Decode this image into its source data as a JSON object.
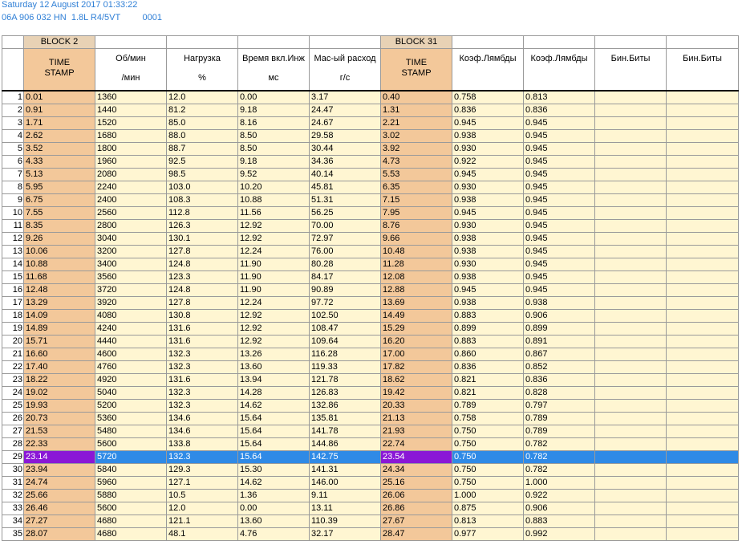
{
  "header": {
    "datetime": "Saturday 12 August 2017 01:33:22",
    "ecu": "06A 906 032 HN  1.8L R4/5VT         0001"
  },
  "blocks": {
    "left": "BLOCK 2",
    "right": "BLOCK 31"
  },
  "columns": [
    {
      "l1": "TIME",
      "l2": "STAMP",
      "ts": true
    },
    {
      "l1": "Об/мин",
      "l2": "/мин"
    },
    {
      "l1": "Нагрузка",
      "l2": "%"
    },
    {
      "l1": "Время вкл.Инж",
      "l2": "мс"
    },
    {
      "l1": "Мас-ый расход",
      "l2": "г/с"
    },
    {
      "l1": "TIME",
      "l2": "STAMP",
      "ts": true
    },
    {
      "l1": "Коэф.Лямбды",
      "l2": ""
    },
    {
      "l1": "Коэф.Лямбды",
      "l2": ""
    },
    {
      "l1": "Бин.Биты",
      "l2": ""
    },
    {
      "l1": "Бин.Биты",
      "l2": ""
    }
  ],
  "selected_row": 29,
  "rows": [
    [
      "1",
      "0.01",
      "1360",
      "12.0",
      "0.00",
      "3.17",
      "0.40",
      "0.758",
      "0.813",
      "",
      ""
    ],
    [
      "2",
      "0.91",
      "1440",
      "81.2",
      "9.18",
      "24.47",
      "1.31",
      "0.836",
      "0.836",
      "",
      ""
    ],
    [
      "3",
      "1.71",
      "1520",
      "85.0",
      "8.16",
      "24.67",
      "2.21",
      "0.945",
      "0.945",
      "",
      ""
    ],
    [
      "4",
      "2.62",
      "1680",
      "88.0",
      "8.50",
      "29.58",
      "3.02",
      "0.938",
      "0.945",
      "",
      ""
    ],
    [
      "5",
      "3.52",
      "1800",
      "88.7",
      "8.50",
      "30.44",
      "3.92",
      "0.930",
      "0.945",
      "",
      ""
    ],
    [
      "6",
      "4.33",
      "1960",
      "92.5",
      "9.18",
      "34.36",
      "4.73",
      "0.922",
      "0.945",
      "",
      ""
    ],
    [
      "7",
      "5.13",
      "2080",
      "98.5",
      "9.52",
      "40.14",
      "5.53",
      "0.945",
      "0.945",
      "",
      ""
    ],
    [
      "8",
      "5.95",
      "2240",
      "103.0",
      "10.20",
      "45.81",
      "6.35",
      "0.930",
      "0.945",
      "",
      ""
    ],
    [
      "9",
      "6.75",
      "2400",
      "108.3",
      "10.88",
      "51.31",
      "7.15",
      "0.938",
      "0.945",
      "",
      ""
    ],
    [
      "10",
      "7.55",
      "2560",
      "112.8",
      "11.56",
      "56.25",
      "7.95",
      "0.945",
      "0.945",
      "",
      ""
    ],
    [
      "11",
      "8.35",
      "2800",
      "126.3",
      "12.92",
      "70.00",
      "8.76",
      "0.930",
      "0.945",
      "",
      ""
    ],
    [
      "12",
      "9.26",
      "3040",
      "130.1",
      "12.92",
      "72.97",
      "9.66",
      "0.938",
      "0.945",
      "",
      ""
    ],
    [
      "13",
      "10.06",
      "3200",
      "127.8",
      "12.24",
      "76.00",
      "10.48",
      "0.938",
      "0.945",
      "",
      ""
    ],
    [
      "14",
      "10.88",
      "3400",
      "124.8",
      "11.90",
      "80.28",
      "11.28",
      "0.930",
      "0.945",
      "",
      ""
    ],
    [
      "15",
      "11.68",
      "3560",
      "123.3",
      "11.90",
      "84.17",
      "12.08",
      "0.938",
      "0.945",
      "",
      ""
    ],
    [
      "16",
      "12.48",
      "3720",
      "124.8",
      "11.90",
      "90.89",
      "12.88",
      "0.945",
      "0.945",
      "",
      ""
    ],
    [
      "17",
      "13.29",
      "3920",
      "127.8",
      "12.24",
      "97.72",
      "13.69",
      "0.938",
      "0.938",
      "",
      ""
    ],
    [
      "18",
      "14.09",
      "4080",
      "130.8",
      "12.92",
      "102.50",
      "14.49",
      "0.883",
      "0.906",
      "",
      ""
    ],
    [
      "19",
      "14.89",
      "4240",
      "131.6",
      "12.92",
      "108.47",
      "15.29",
      "0.899",
      "0.899",
      "",
      ""
    ],
    [
      "20",
      "15.71",
      "4440",
      "131.6",
      "12.92",
      "109.64",
      "16.20",
      "0.883",
      "0.891",
      "",
      ""
    ],
    [
      "21",
      "16.60",
      "4600",
      "132.3",
      "13.26",
      "116.28",
      "17.00",
      "0.860",
      "0.867",
      "",
      ""
    ],
    [
      "22",
      "17.40",
      "4760",
      "132.3",
      "13.60",
      "119.33",
      "17.82",
      "0.836",
      "0.852",
      "",
      ""
    ],
    [
      "23",
      "18.22",
      "4920",
      "131.6",
      "13.94",
      "121.78",
      "18.62",
      "0.821",
      "0.836",
      "",
      ""
    ],
    [
      "24",
      "19.02",
      "5040",
      "132.3",
      "14.28",
      "126.83",
      "19.42",
      "0.821",
      "0.828",
      "",
      ""
    ],
    [
      "25",
      "19.93",
      "5200",
      "132.3",
      "14.62",
      "132.86",
      "20.33",
      "0.789",
      "0.797",
      "",
      ""
    ],
    [
      "26",
      "20.73",
      "5360",
      "134.6",
      "15.64",
      "135.81",
      "21.13",
      "0.758",
      "0.789",
      "",
      ""
    ],
    [
      "27",
      "21.53",
      "5480",
      "134.6",
      "15.64",
      "141.78",
      "21.93",
      "0.750",
      "0.789",
      "",
      ""
    ],
    [
      "28",
      "22.33",
      "5600",
      "133.8",
      "15.64",
      "144.86",
      "22.74",
      "0.750",
      "0.782",
      "",
      ""
    ],
    [
      "29",
      "23.14",
      "5720",
      "132.3",
      "15.64",
      "142.75",
      "23.54",
      "0.750",
      "0.782",
      "",
      ""
    ],
    [
      "30",
      "23.94",
      "5840",
      "129.3",
      "15.30",
      "141.31",
      "24.34",
      "0.750",
      "0.782",
      "",
      ""
    ],
    [
      "31",
      "24.74",
      "5960",
      "127.1",
      "14.62",
      "146.00",
      "25.16",
      "0.750",
      "1.000",
      "",
      ""
    ],
    [
      "32",
      "25.66",
      "5880",
      "10.5",
      "1.36",
      "9.11",
      "26.06",
      "1.000",
      "0.922",
      "",
      ""
    ],
    [
      "33",
      "26.46",
      "5600",
      "12.0",
      "0.00",
      "13.11",
      "26.86",
      "0.875",
      "0.906",
      "",
      ""
    ],
    [
      "34",
      "27.27",
      "4680",
      "121.1",
      "13.60",
      "110.39",
      "27.67",
      "0.813",
      "0.883",
      "",
      ""
    ],
    [
      "35",
      "28.07",
      "4680",
      "48.1",
      "4.76",
      "32.17",
      "28.47",
      "0.977",
      "0.992",
      "",
      ""
    ]
  ]
}
